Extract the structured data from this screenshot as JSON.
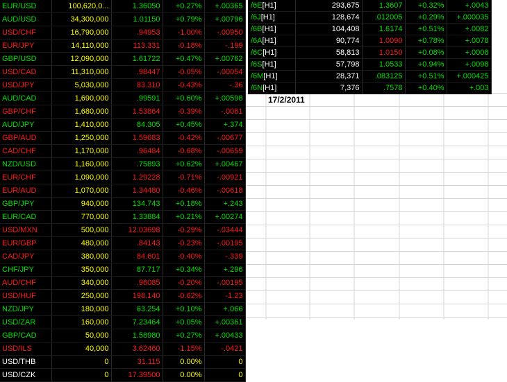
{
  "date_cell": "17/2/2011",
  "fx_rows": [
    {
      "symbol": "EUR/USD",
      "volume": "100,620,0...",
      "price": "1.36050",
      "pct": "+0.27%",
      "chg": "+.00365",
      "dir": "up"
    },
    {
      "symbol": "AUD/USD",
      "volume": "34,300,000",
      "price": "1.01150",
      "pct": "+0.79%",
      "chg": "+.00796",
      "dir": "up"
    },
    {
      "symbol": "USD/CHF",
      "volume": "16,790,000",
      "price": ".94953",
      "pct": "-1.00%",
      "chg": "-.00950",
      "dir": "down"
    },
    {
      "symbol": "EUR/JPY",
      "volume": "14,110,000",
      "price": "113.331",
      "pct": "-0.18%",
      "chg": "-.199",
      "dir": "down"
    },
    {
      "symbol": "GBP/USD",
      "volume": "12,090,000",
      "price": "1.61722",
      "pct": "+0.47%",
      "chg": "+.00762",
      "dir": "up"
    },
    {
      "symbol": "USD/CAD",
      "volume": "11,310,000",
      "price": ".98447",
      "pct": "-0.05%",
      "chg": "-.00054",
      "dir": "down"
    },
    {
      "symbol": "USD/JPY",
      "volume": "5,030,000",
      "price": "83.310",
      "pct": "-0.43%",
      "chg": "-.36",
      "dir": "down"
    },
    {
      "symbol": "AUD/CAD",
      "volume": "1,690,000",
      "price": ".99591",
      "pct": "+0.60%",
      "chg": "+.00598",
      "dir": "up"
    },
    {
      "symbol": "GBP/CHF",
      "volume": "1,680,000",
      "price": "1.53864",
      "pct": "-0.39%",
      "chg": "-.0061",
      "dir": "down"
    },
    {
      "symbol": "AUD/JPY",
      "volume": "1,410,000",
      "price": "84.305",
      "pct": "+0.45%",
      "chg": "+.374",
      "dir": "up"
    },
    {
      "symbol": "GBP/AUD",
      "volume": "1,250,000",
      "price": "1.59683",
      "pct": "-0.42%",
      "chg": "-.00677",
      "dir": "down"
    },
    {
      "symbol": "CAD/CHF",
      "volume": "1,170,000",
      "price": ".96484",
      "pct": "-0.68%",
      "chg": "-.00659",
      "dir": "down"
    },
    {
      "symbol": "NZD/USD",
      "volume": "1,160,000",
      "price": ".75893",
      "pct": "+0.62%",
      "chg": "+.00467",
      "dir": "up"
    },
    {
      "symbol": "EUR/CHF",
      "volume": "1,090,000",
      "price": "1.29228",
      "pct": "-0.71%",
      "chg": "-.00921",
      "dir": "down"
    },
    {
      "symbol": "EUR/AUD",
      "volume": "1,070,000",
      "price": "1.34480",
      "pct": "-0.46%",
      "chg": "-.00618",
      "dir": "down"
    },
    {
      "symbol": "GBP/JPY",
      "volume": "940,000",
      "price": "134.743",
      "pct": "+0.18%",
      "chg": "+.243",
      "dir": "up"
    },
    {
      "symbol": "EUR/CAD",
      "volume": "770,000",
      "price": "1.33884",
      "pct": "+0.21%",
      "chg": "+.00274",
      "dir": "up"
    },
    {
      "symbol": "USD/MXN",
      "volume": "500,000",
      "price": "12.03698",
      "pct": "-0.29%",
      "chg": "-.03444",
      "dir": "down"
    },
    {
      "symbol": "EUR/GBP",
      "volume": "480,000",
      "price": ".84143",
      "pct": "-0.23%",
      "chg": "-.00195",
      "dir": "down"
    },
    {
      "symbol": "CAD/JPY",
      "volume": "380,000",
      "price": "84.601",
      "pct": "-0.40%",
      "chg": "-.339",
      "dir": "down"
    },
    {
      "symbol": "CHF/JPY",
      "volume": "350,000",
      "price": "87.717",
      "pct": "+0.34%",
      "chg": "+.296",
      "dir": "up"
    },
    {
      "symbol": "AUD/CHF",
      "volume": "340,000",
      "price": ".96085",
      "pct": "-0.20%",
      "chg": "-.00195",
      "dir": "down"
    },
    {
      "symbol": "USD/HUF",
      "volume": "250,000",
      "price": "198.140",
      "pct": "-0.62%",
      "chg": "-1.23",
      "dir": "down"
    },
    {
      "symbol": "NZD/JPY",
      "volume": "180,000",
      "price": "63.254",
      "pct": "+0.10%",
      "chg": "+.066",
      "dir": "up"
    },
    {
      "symbol": "USD/ZAR",
      "volume": "160,000",
      "price": "7.23464",
      "pct": "+0.05%",
      "chg": "+.00361",
      "dir": "up"
    },
    {
      "symbol": "GBP/CAD",
      "volume": "50,000",
      "price": "1.58980",
      "pct": "+0.27%",
      "chg": "+.00433",
      "dir": "up"
    },
    {
      "symbol": "USD/ILS",
      "volume": "40,000",
      "price": "3.62460",
      "pct": "-1.15%",
      "chg": "-.0421",
      "dir": "down"
    },
    {
      "symbol": "USD/THB",
      "volume": "0",
      "price": "31.115",
      "pct": "0.00%",
      "chg": "0",
      "dir": "flat"
    },
    {
      "symbol": "USD/CZK",
      "volume": "0",
      "price": "17.39500",
      "pct": "0.00%",
      "chg": "0",
      "dir": "flat"
    }
  ],
  "futures_rows": [
    {
      "symbol": "/6E",
      "tag": "[H1]",
      "volume": "293,675",
      "price": "1.3607",
      "pct": "+0.32%",
      "chg": "+.0043",
      "dir": "up"
    },
    {
      "symbol": "/6J",
      "tag": "[H1]",
      "volume": "128,674",
      "price": ".012005",
      "pct": "+0.29%",
      "chg": "+.000035",
      "dir": "up"
    },
    {
      "symbol": "/6B",
      "tag": "[H1]",
      "volume": "104,408",
      "price": "1.6174",
      "pct": "+0.51%",
      "chg": "+.0082",
      "dir": "up"
    },
    {
      "symbol": "/6A",
      "tag": "[H1]",
      "volume": "90,774",
      "price": "1.0090",
      "pct": "+0.78%",
      "chg": "+.0078",
      "dir": "down"
    },
    {
      "symbol": "/6C",
      "tag": "[H1]",
      "volume": "58,813",
      "price": "1.0150",
      "pct": "+0.08%",
      "chg": "+.0008",
      "dir": "down"
    },
    {
      "symbol": "/6S",
      "tag": "[H1]",
      "volume": "57,798",
      "price": "1.0533",
      "pct": "+0.94%",
      "chg": "+.0098",
      "dir": "up"
    },
    {
      "symbol": "/6M",
      "tag": "[H1]",
      "volume": "28,371",
      "price": ".083125",
      "pct": "+0.51%",
      "chg": "+.000425",
      "dir": "up"
    },
    {
      "symbol": "/6N",
      "tag": "[H1]",
      "volume": "7,376",
      "price": ".7578",
      "pct": "+0.40%",
      "chg": "+.003",
      "dir": "up"
    }
  ]
}
